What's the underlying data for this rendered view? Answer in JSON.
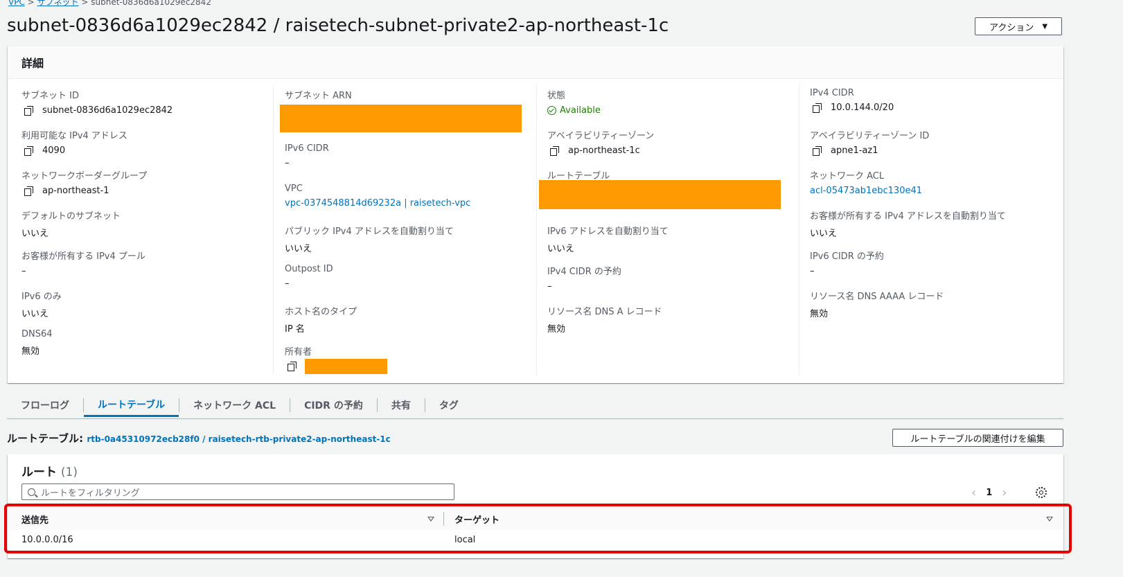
{
  "breadcrumb": {
    "items": [
      "VPC",
      "サブネット",
      "subnet-0836d6a1029ec2842"
    ]
  },
  "header": {
    "title": "subnet-0836d6a1029ec2842 / raisetech-subnet-private2-ap-northeast-1c",
    "actions_label": "アクション"
  },
  "details": {
    "heading": "詳細",
    "col1": {
      "subnet_id_label": "サブネット ID",
      "subnet_id": "subnet-0836d6a1029ec2842",
      "avail_ipv4_label": "利用可能な IPv4 アドレス",
      "avail_ipv4": "4090",
      "nbg_label": "ネットワークボーダーグループ",
      "nbg": "ap-northeast-1",
      "default_subnet_label": "デフォルトのサブネット",
      "default_subnet": "いいえ",
      "customer_pool_label": "お客様が所有する IPv4 プール",
      "customer_pool": "–",
      "ipv6_only_label": "IPv6 のみ",
      "ipv6_only": "いいえ",
      "dns64_label": "DNS64",
      "dns64": "無効"
    },
    "col2": {
      "arn_label": "サブネット ARN",
      "ipv6_cidr_label": "IPv6 CIDR",
      "ipv6_cidr": "–",
      "vpc_label": "VPC",
      "vpc": "vpc-0374548814d69232a | raisetech-vpc",
      "public_ipv4_label": "パブリック IPv4 アドレスを自動割り当て",
      "public_ipv4": "いいえ",
      "outpost_label": "Outpost ID",
      "outpost": "–",
      "hostname_type_label": "ホスト名のタイプ",
      "hostname_type": "IP 名",
      "owner_label": "所有者"
    },
    "col3": {
      "state_label": "状態",
      "state": "Available",
      "az_label": "アベイラビリティーゾーン",
      "az": "ap-northeast-1c",
      "route_table_label": "ルートテーブル",
      "ipv6_auto_label": "IPv6 アドレスを自動割り当て",
      "ipv6_auto": "いいえ",
      "ipv4_reserve_label": "IPv4 CIDR の予約",
      "ipv4_reserve": "–",
      "dns_a_label": "リソース名 DNS A レコード",
      "dns_a": "無効"
    },
    "col4": {
      "ipv4_cidr_label": "IPv4 CIDR",
      "ipv4_cidr": "10.0.144.0/20",
      "az_id_label": "アベイラビリティーゾーン ID",
      "az_id": "apne1-az1",
      "acl_label": "ネットワーク ACL",
      "acl": "acl-05473ab1ebc130e41",
      "customer_ipv4_label": "お客様が所有する IPv4 アドレスを自動割り当て",
      "customer_ipv4": "いいえ",
      "ipv6_reserve_label": "IPv6 CIDR の予約",
      "ipv6_reserve": "–",
      "dns_aaaa_label": "リソース名 DNS AAAA レコード",
      "dns_aaaa": "無効"
    }
  },
  "tabs": [
    "フローログ",
    "ルートテーブル",
    "ネットワーク ACL",
    "CIDR の予約",
    "共有",
    "タグ"
  ],
  "route_table": {
    "label": "ルートテーブル:",
    "link": "rtb-0a45310972ecb28f0 / raisetech-rtb-private2-ap-northeast-1c",
    "edit_button": "ルートテーブルの関連付けを編集"
  },
  "routes": {
    "heading": "ルート",
    "count": "(1)",
    "filter_placeholder": "ルートをフィルタリング",
    "page": "1",
    "columns": [
      "送信先",
      "ターゲット"
    ],
    "rows": [
      {
        "destination": "10.0.0.0/16",
        "target": "local"
      }
    ]
  },
  "colors": {
    "accent": "#0073bb",
    "redaction": "#ff9900",
    "highlight": "#e50000",
    "ok": "#1d8102"
  }
}
